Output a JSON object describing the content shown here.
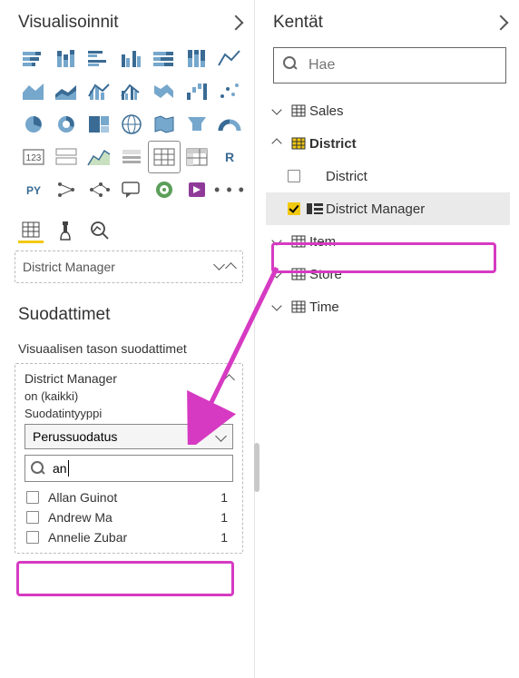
{
  "visualizations": {
    "title": "Visualisoinnit",
    "field_well_value": "District Manager"
  },
  "filters": {
    "title": "Suodattimet",
    "visual_level_label": "Visuaalisen tason suodattimet",
    "card": {
      "title": "District Manager",
      "summary": "on (kaikki)",
      "type_label": "Suodatintyyppi",
      "type_value": "Perussuodatus",
      "search_value": "an",
      "values": [
        {
          "label": "Allan Guinot",
          "count": "1"
        },
        {
          "label": "Andrew Ma",
          "count": "1"
        },
        {
          "label": "Annelie Zubar",
          "count": "1"
        }
      ]
    }
  },
  "fields": {
    "title": "Kentät",
    "search_placeholder": "Hae",
    "tables": {
      "sales": "Sales",
      "district": "District",
      "district_col": "District",
      "district_manager_col": "District Manager",
      "item": "Item",
      "store": "Store",
      "time": "Time"
    }
  }
}
